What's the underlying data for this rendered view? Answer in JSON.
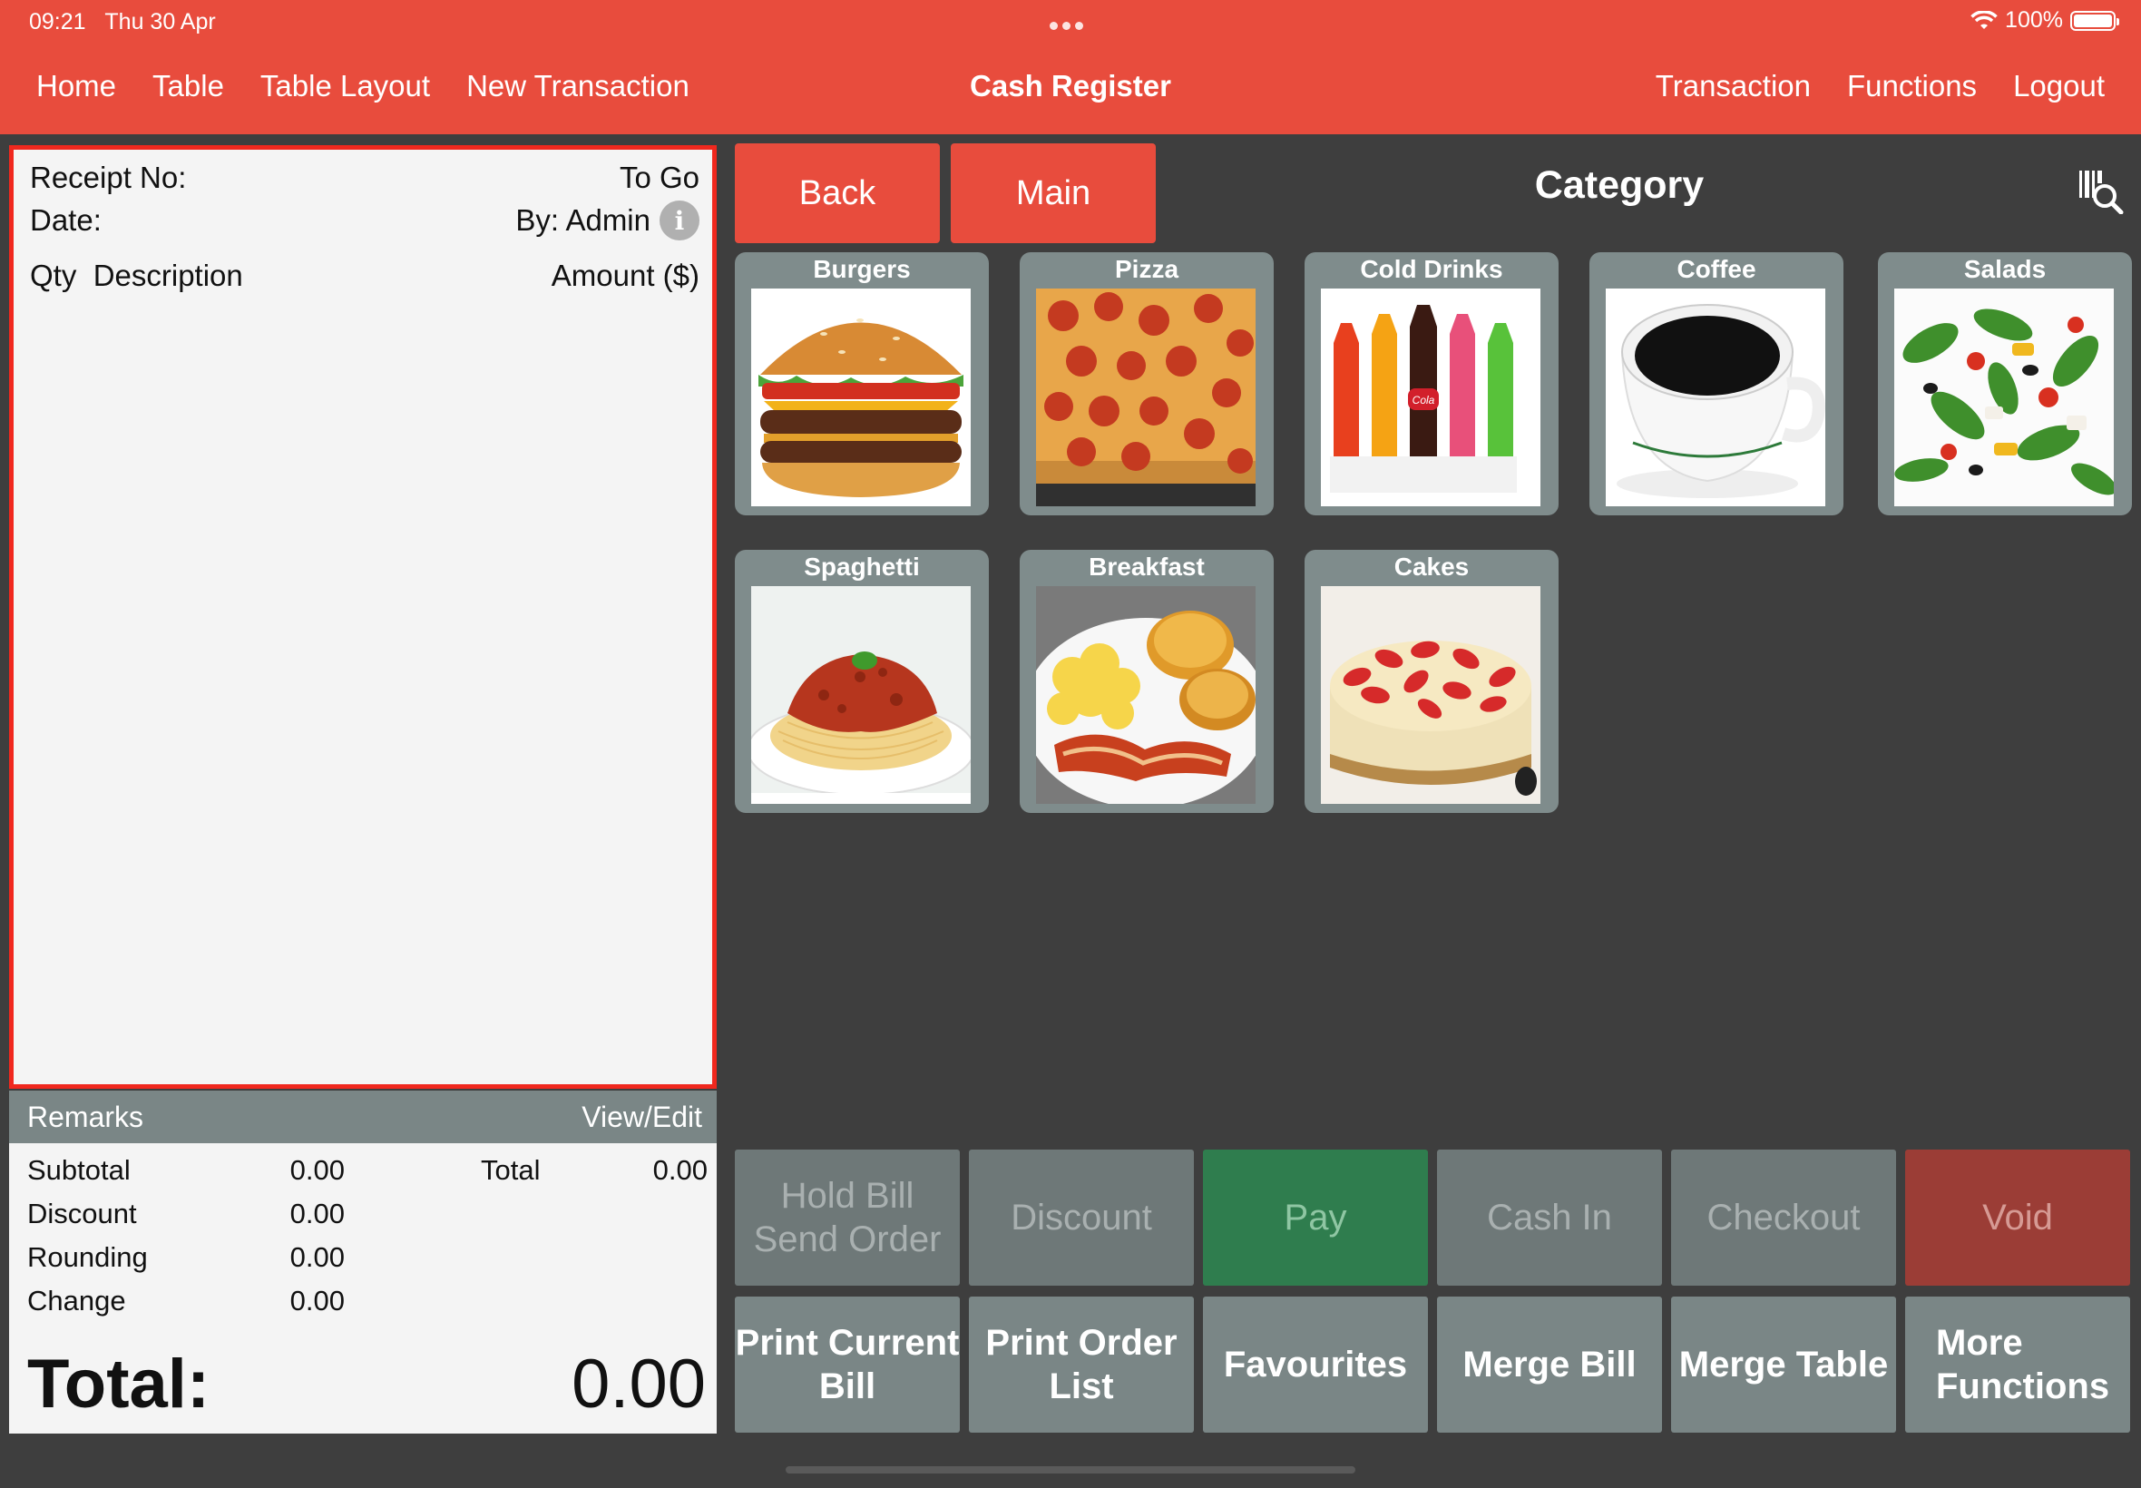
{
  "status_bar": {
    "time": "09:21",
    "date": "Thu 30 Apr",
    "battery": "100%"
  },
  "nav": {
    "left": [
      "Home",
      "Table",
      "Table Layout",
      "New Transaction"
    ],
    "title": "Cash Register",
    "right": [
      "Transaction",
      "Functions",
      "Logout"
    ]
  },
  "receipt": {
    "receipt_no_label": "Receipt No:",
    "order_type": "To Go",
    "date_label": "Date:",
    "by_label": "By: Admin",
    "col_qty": "Qty",
    "col_desc": "Description",
    "col_amount": "Amount ($)"
  },
  "remarks": {
    "label": "Remarks",
    "action": "View/Edit"
  },
  "totals": {
    "subtotal_label": "Subtotal",
    "subtotal": "0.00",
    "discount_label": "Discount",
    "discount": "0.00",
    "rounding_label": "Rounding",
    "rounding": "0.00",
    "change_label": "Change",
    "change": "0.00",
    "total_label": "Total",
    "total": "0.00",
    "grand_label": "Total:",
    "grand": "0.00"
  },
  "category": {
    "back": "Back",
    "main": "Main",
    "title": "Category",
    "items": [
      {
        "label": "Burgers",
        "icon": "burger-image"
      },
      {
        "label": "Pizza",
        "icon": "pizza-image"
      },
      {
        "label": "Cold Drinks",
        "icon": "cold-drinks-image"
      },
      {
        "label": "Coffee",
        "icon": "coffee-image"
      },
      {
        "label": "Salads",
        "icon": "salad-image"
      },
      {
        "label": "Spaghetti",
        "icon": "spaghetti-image"
      },
      {
        "label": "Breakfast",
        "icon": "breakfast-image"
      },
      {
        "label": "Cakes",
        "icon": "cake-image"
      }
    ],
    "cola_text": "Cola"
  },
  "actions": {
    "row1": [
      "Hold Bill\nSend Order",
      "Discount",
      "Pay",
      "Cash In",
      "Checkout",
      "Void"
    ],
    "row2": [
      "Print Current\nBill",
      "Print Order\nList",
      "Favourites",
      "Merge Bill",
      "Merge Table",
      "More\nFunctions"
    ]
  },
  "colors": {
    "header": "#e84c3d",
    "pay": "#2f7d4e",
    "void": "#9b3d36",
    "receipt_border": "#f0281e"
  }
}
